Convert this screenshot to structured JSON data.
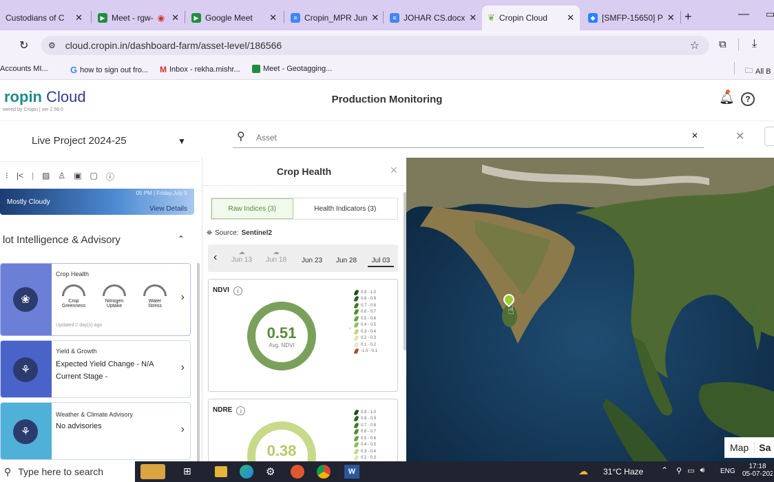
{
  "browser": {
    "tabs": [
      {
        "label": "Custodians of C",
        "active": false
      },
      {
        "label": "Meet - rgw-",
        "active": false
      },
      {
        "label": "Google Meet",
        "active": false
      },
      {
        "label": "Cropin_MPR Jun",
        "active": false
      },
      {
        "label": "JOHAR CS.docx",
        "active": false
      },
      {
        "label": "Cropin Cloud",
        "active": true
      },
      {
        "label": "[SMFP-15650] P",
        "active": false
      }
    ],
    "new_tab": "+",
    "url": "cloud.cropin.in/dashboard-farm/asset-level/186566",
    "bookmarks": [
      "Accounts MI...",
      "how to sign out fro...",
      "Inbox - rekha.mishr...",
      "Meet - Geotagging..."
    ],
    "all_bookmarks": "All B"
  },
  "app": {
    "logo_brand": "ropin",
    "logo_product": "Cloud",
    "logo_sub": "wered by Cropin",
    "version": "ver 2.58.0",
    "title": "Production Monitoring",
    "colors": {
      "brand": "#1f8a8a",
      "accent": "#6b7fd7",
      "ndvi": "#7ba05b"
    }
  },
  "left": {
    "project": "Live Project 2024-25",
    "weather_time": "05 PM | Friday,July 5",
    "weather_desc": "Mostly Cloudy",
    "view_details": "View Details",
    "section_title": "lot Intelligence & Advisory",
    "crop_health_card": {
      "title": "Crop Health",
      "gauges": [
        {
          "label1": "Crop",
          "label2": "Greenness"
        },
        {
          "label1": "Nitrogen",
          "label2": "Uptake"
        },
        {
          "label1": "Water",
          "label2": "Stress"
        }
      ],
      "updated": "Updated 2 day(s) ago"
    },
    "yield_card": {
      "title": "Yield & Growth",
      "line1": "Expected Yield Change - N/A",
      "line2": "Current Stage -"
    },
    "weather_card": {
      "title": "Weather & Climate Advisory",
      "line1": "No advisories"
    }
  },
  "search": {
    "placeholder": "Asset"
  },
  "crop_health": {
    "title": "Crop Health",
    "tabs": [
      "Raw Indices (3)",
      "Health Indicators (3)"
    ],
    "source_label": "Source:",
    "source": "Sentinel2",
    "dates": [
      "Jun 13",
      "Jun 18",
      "Jun 23",
      "Jun 28",
      "Jul 03"
    ],
    "ndvi": {
      "label": "NDVI",
      "value": "0.51",
      "caption": "Avg. NDVI"
    },
    "ndre": {
      "label": "NDRE",
      "value": "0.38"
    },
    "legend": [
      {
        "range": "0.9 - 1.0",
        "color": "#1e4d1a"
      },
      {
        "range": "0.8 - 0.9",
        "color": "#2b6220"
      },
      {
        "range": "0.7 - 0.8",
        "color": "#3d7a28"
      },
      {
        "range": "0.6 - 0.7",
        "color": "#4f8f30"
      },
      {
        "range": "0.5 - 0.6",
        "color": "#6aa33f"
      },
      {
        "range": "0.4 - 0.5",
        "color": "#93bd5a"
      },
      {
        "range": "0.3 - 0.4",
        "color": "#c2d68a"
      },
      {
        "range": "0.2 - 0.3",
        "color": "#e1e4b4"
      },
      {
        "range": "0.1 - 0.2",
        "color": "#efe6cf"
      },
      {
        "range": "-1.0 - 0.1",
        "color": "#a0522d"
      }
    ]
  },
  "map": {
    "type_map": "Map",
    "type_sat": "Sa"
  },
  "taskbar": {
    "search_placeholder": "Type here to search",
    "weather": "31°C Haze",
    "lang": "ENG",
    "time": "17:18",
    "date": "05-07-202"
  }
}
